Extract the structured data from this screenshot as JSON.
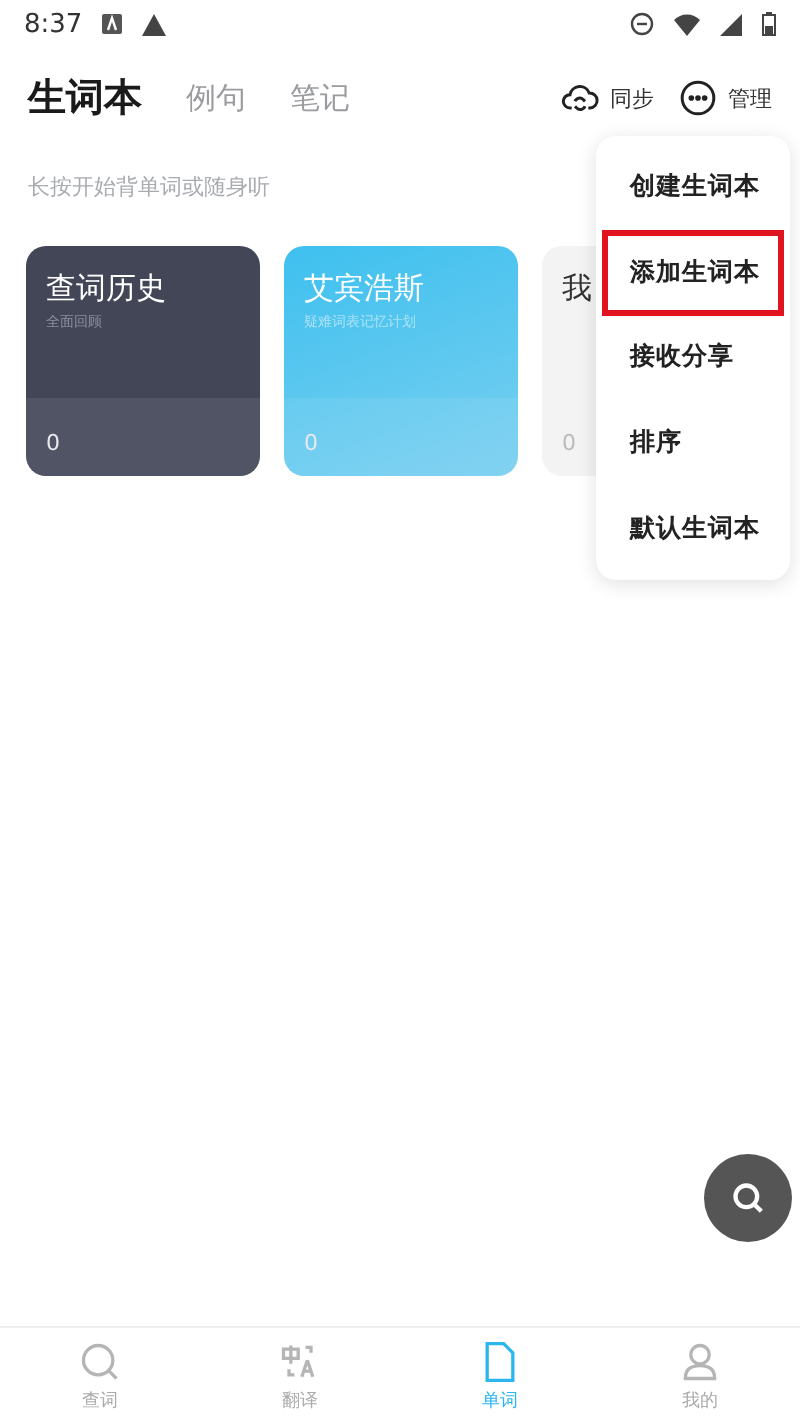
{
  "status_bar": {
    "time": "8:37"
  },
  "header": {
    "tabs": [
      {
        "label": "生词本",
        "selected": true
      },
      {
        "label": "例句",
        "selected": false
      },
      {
        "label": "笔记",
        "selected": false
      }
    ],
    "actions": [
      {
        "kind": "sync",
        "label": "同步"
      },
      {
        "kind": "more",
        "label": "管理"
      }
    ]
  },
  "hint": "长按开始背单词或随身听",
  "wordbooks": [
    {
      "title": "查词历史",
      "subtitle": "全面回顾",
      "count": "0",
      "kind": "dark"
    },
    {
      "title": "艾宾浩斯",
      "subtitle": "疑难词表记忆计划",
      "count": "0",
      "kind": "blue"
    },
    {
      "title": "我",
      "count": "0",
      "kind": "light"
    }
  ],
  "menu": [
    {
      "label": "创建生词本",
      "highlighted": false
    },
    {
      "label": "添加生词本",
      "highlighted": true
    },
    {
      "label": "接收分享",
      "highlighted": false
    },
    {
      "label": "排序",
      "highlighted": false
    },
    {
      "label": "默认生词本",
      "highlighted": false
    }
  ],
  "bottom_nav": [
    {
      "kind": "search",
      "label": "查词",
      "selected": false
    },
    {
      "kind": "translate",
      "label": "翻译",
      "selected": false
    },
    {
      "kind": "words",
      "label": "单词",
      "selected": true
    },
    {
      "kind": "me",
      "label": "我的",
      "selected": false
    }
  ]
}
